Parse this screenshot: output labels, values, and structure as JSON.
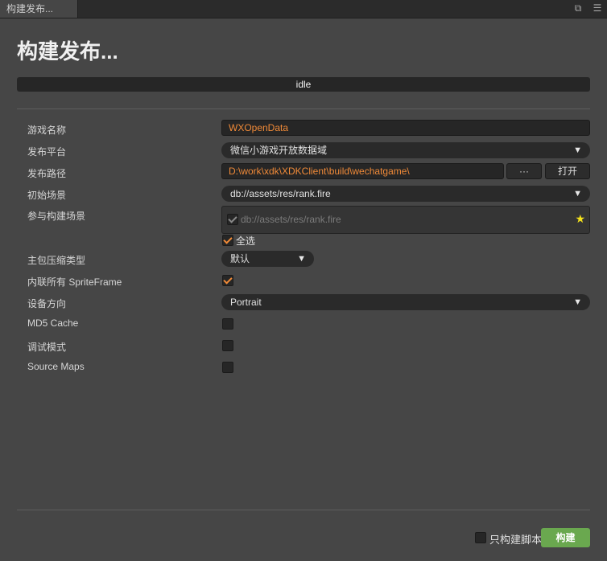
{
  "tab": {
    "label": "构建发布..."
  },
  "title": "构建发布...",
  "status": "idle",
  "fields": {
    "game_name_label": "游戏名称",
    "game_name_value": "WXOpenData",
    "platform_label": "发布平台",
    "platform_value": "微信小游戏开放数据域",
    "path_label": "发布路径",
    "path_value": "D:\\work\\xdk\\XDKClient\\build\\wechatgame\\",
    "path_browse": "···",
    "path_open": "打开",
    "start_scene_label": "初始场景",
    "start_scene_value": "db://assets/res/rank.fire",
    "scenes_label": "参与构建场景",
    "scenes_item": "db://assets/res/rank.fire",
    "select_all": "全选",
    "compression_label": "主包压缩类型",
    "compression_value": "默认",
    "inline_sprite_label": "内联所有 SpriteFrame",
    "orientation_label": "设备方向",
    "orientation_value": "Portrait",
    "md5_label": "MD5 Cache",
    "debug_label": "调试模式",
    "sourcemaps_label": "Source Maps"
  },
  "footer": {
    "scripts_only_label": "只构建脚本",
    "build_label": "构建"
  },
  "colors": {
    "accent": "#f08a38",
    "build": "#6aa84f",
    "star": "#f5e21b"
  },
  "state": {
    "scene_checked": true,
    "select_all_checked": true,
    "inline_sprite_checked": true,
    "md5_checked": false,
    "debug_checked": false,
    "sourcemaps_checked": false,
    "scripts_only_checked": false
  }
}
